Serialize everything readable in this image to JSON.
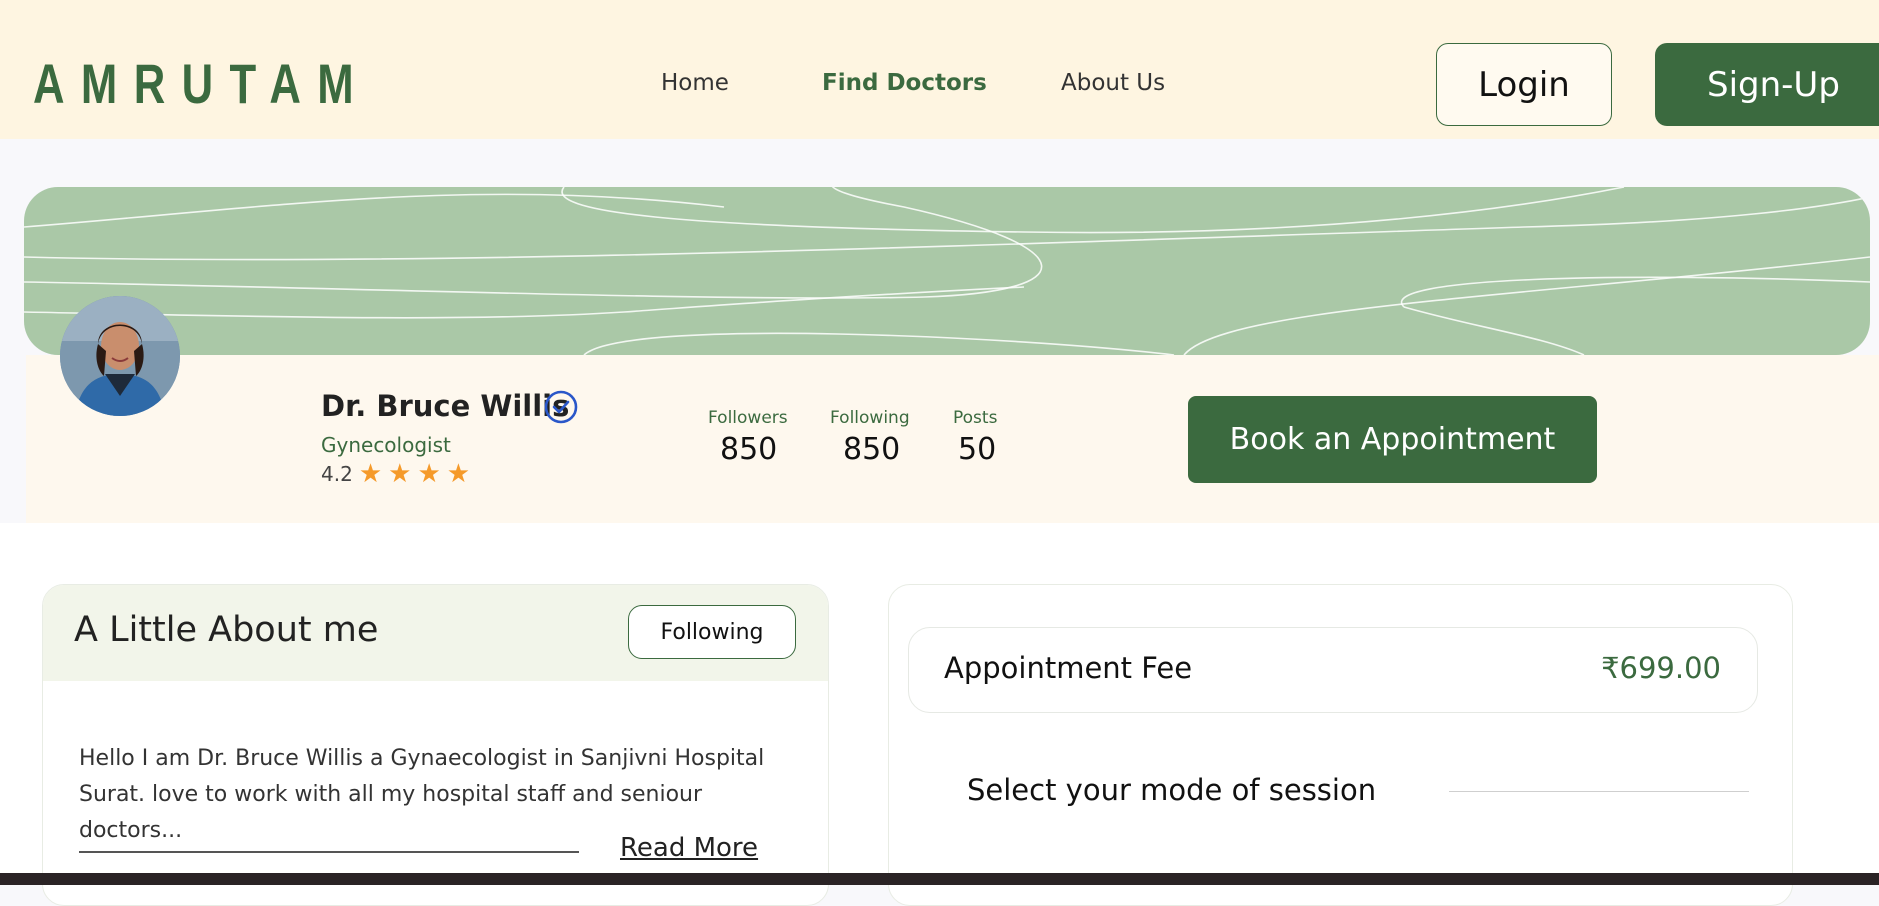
{
  "header": {
    "logo": "AMRUTAM",
    "nav": [
      "Home",
      "Find Doctors",
      "About Us"
    ],
    "active_nav": "Find Doctors",
    "login_label": "Login",
    "signup_label": "Sign-Up"
  },
  "profile": {
    "name": "Dr. Bruce Willis",
    "specialty": "Gynecologist",
    "rating": "4.2",
    "stars": 4,
    "stats": [
      {
        "label": "Followers",
        "value": "850"
      },
      {
        "label": "Following",
        "value": "850"
      },
      {
        "label": "Posts",
        "value": "50"
      }
    ],
    "book_label": "Book an Appointment"
  },
  "about": {
    "title": "A Little About me",
    "follow_label": "Following",
    "text": "Hello I am Dr. Bruce Willis a Gynaecologist in Sanjivni Hospital Surat. love to work with all my hospital staff and seniour doctors...",
    "read_more": "Read More"
  },
  "booking": {
    "fee_label": "Appointment Fee",
    "fee_value": "₹699.00",
    "session_label": "Select your mode of session"
  },
  "colors": {
    "brand_green": "#3b6a3f",
    "header_bg": "#fef5e1",
    "banner_green": "#aac8a7",
    "star": "#f59a2a"
  }
}
